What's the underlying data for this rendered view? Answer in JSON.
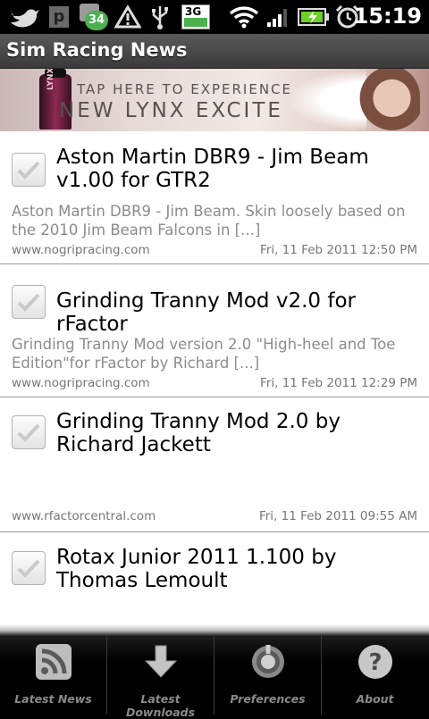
{
  "status_bar": {
    "time": "15:19",
    "notification_badge": "34",
    "network_type": "3G"
  },
  "app": {
    "title": "Sim Racing News"
  },
  "ad": {
    "line1": "TAP HERE TO EXPERIENCE",
    "line2": "NEW LYNX EXCITE",
    "brand": "LYNX"
  },
  "news": [
    {
      "title": "Aston Martin DBR9 - Jim Beam v1.00 for GTR2",
      "summary": "Aston Martin DBR9 - Jim Beam. Skin loosely based on the 2010 Jim Beam Falcons in  [...]",
      "source": "www.nogripracing.com",
      "date": "Fri, 11 Feb 2011 12:50 PM"
    },
    {
      "title": "Grinding Tranny Mod v2.0 for rFactor",
      "summary": "Grinding Tranny Mod version 2.0 \"High-heel and Toe Edition\"for rFactor by Richard [...]",
      "source": "www.nogripracing.com",
      "date": "Fri, 11 Feb 2011 12:29 PM"
    },
    {
      "title": "Grinding Tranny Mod 2.0 by Richard Jackett",
      "summary": "",
      "source": "www.rfactorcentral.com",
      "date": "Fri, 11 Feb 2011 09:55 AM"
    },
    {
      "title": "Rotax Junior 2011 1.100 by Thomas Lemoult",
      "summary": "",
      "source": "",
      "date": ""
    }
  ],
  "tabs": [
    {
      "label": "Latest News",
      "icon": "rss-icon"
    },
    {
      "label": "Latest Downloads",
      "icon": "download-arrow-icon"
    },
    {
      "label": "Preferences",
      "icon": "gear-icon"
    },
    {
      "label": "About",
      "icon": "question-icon"
    }
  ]
}
